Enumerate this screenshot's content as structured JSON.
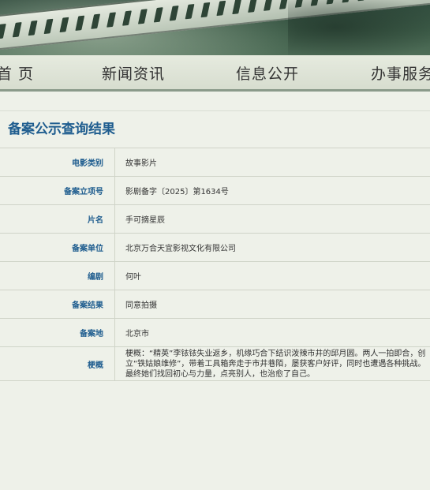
{
  "nav": {
    "items": [
      "首 页",
      "新闻资讯",
      "信息公开",
      "办事服务"
    ]
  },
  "page": {
    "title": "备案公示查询结果"
  },
  "record": {
    "rows": [
      {
        "label": "电影类别",
        "value": "故事影片"
      },
      {
        "label": "备案立项号",
        "value": "影剧备字〔2025〕第1634号"
      },
      {
        "label": "片名",
        "value": "手可摘星辰"
      },
      {
        "label": "备案单位",
        "value": "北京万合天宜影视文化有限公司"
      },
      {
        "label": "编剧",
        "value": "何叶"
      },
      {
        "label": "备案结果",
        "value": "同意拍摄"
      },
      {
        "label": "备案地",
        "value": "北京市"
      },
      {
        "label": "梗概",
        "value": "梗概：“精英”李铱铱失业返乡，机缘巧合下结识泼辣市井的邱月圆。两人一拍即合，创立“铁姑娘维修”，带着工具箱奔走于市井巷陌，屡获客户好评，同时也遭遇各种挑战。最终她们找回初心与力量，点亮别人，也治愈了自己。"
      }
    ]
  },
  "colors": {
    "accent": "#1f5d8f",
    "background": "#eef1e9",
    "banner": "#3d5c48"
  }
}
